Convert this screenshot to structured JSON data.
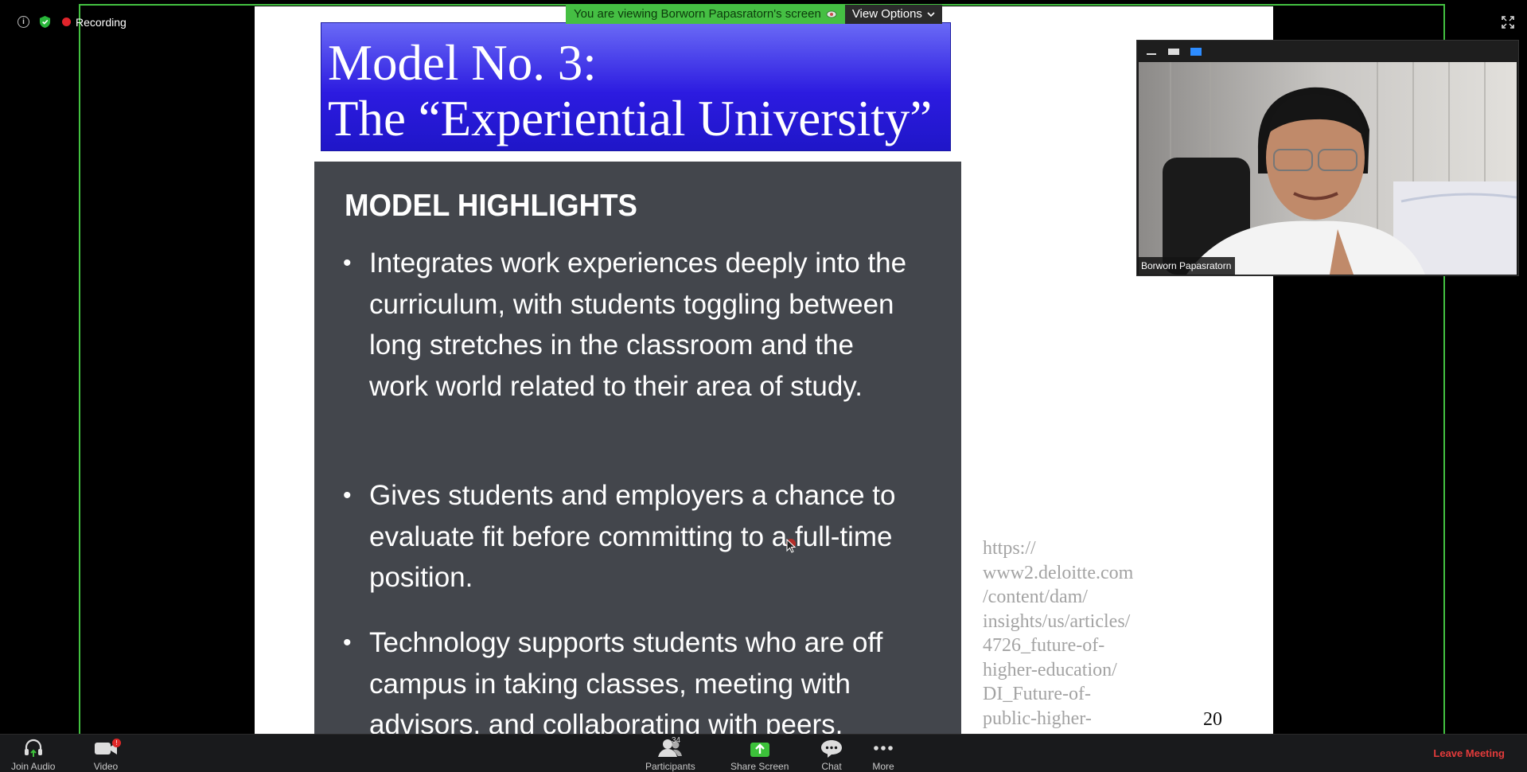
{
  "meeting": {
    "recording_label": "Recording"
  },
  "banner": {
    "message": "You are viewing Borworn Papasratorn's screen",
    "view_options_label": "View Options"
  },
  "slide": {
    "title_line_1": "Model No. 3:",
    "title_line_2": "The “Experiential University”",
    "heading": "MODEL HIGHLIGHTS",
    "bullets": [
      "Integrates work experiences deeply into the curriculum, with students toggling between long stretches in the classroom and the work world related to their area of study.",
      "Gives students and employers a chance to evaluate fit before committing to a full-time position.",
      "Technology supports students who are off campus in taking classes, meeting with advisors, and collaborating with peers."
    ],
    "source_url": "https://\nwww2.deloitte.com\n/content/dam/\ninsights/us/articles/\n4726_future-of-\nhigher-education/\nDI_Future-of-\npublic-higher-",
    "page_number": "20"
  },
  "video_tile": {
    "participant_name": "Borworn Papasratorn"
  },
  "toolbar": {
    "join_audio_label": "Join Audio",
    "video_label": "Video",
    "video_badge": "!",
    "participants_label": "Participants",
    "participants_count": "34",
    "share_screen_label": "Share Screen",
    "chat_label": "Chat",
    "more_label": "More",
    "leave_label": "Leave Meeting"
  },
  "colors": {
    "share_border": "#43c141",
    "leave": "#e33b3b",
    "recording_dot": "#e0242b"
  }
}
